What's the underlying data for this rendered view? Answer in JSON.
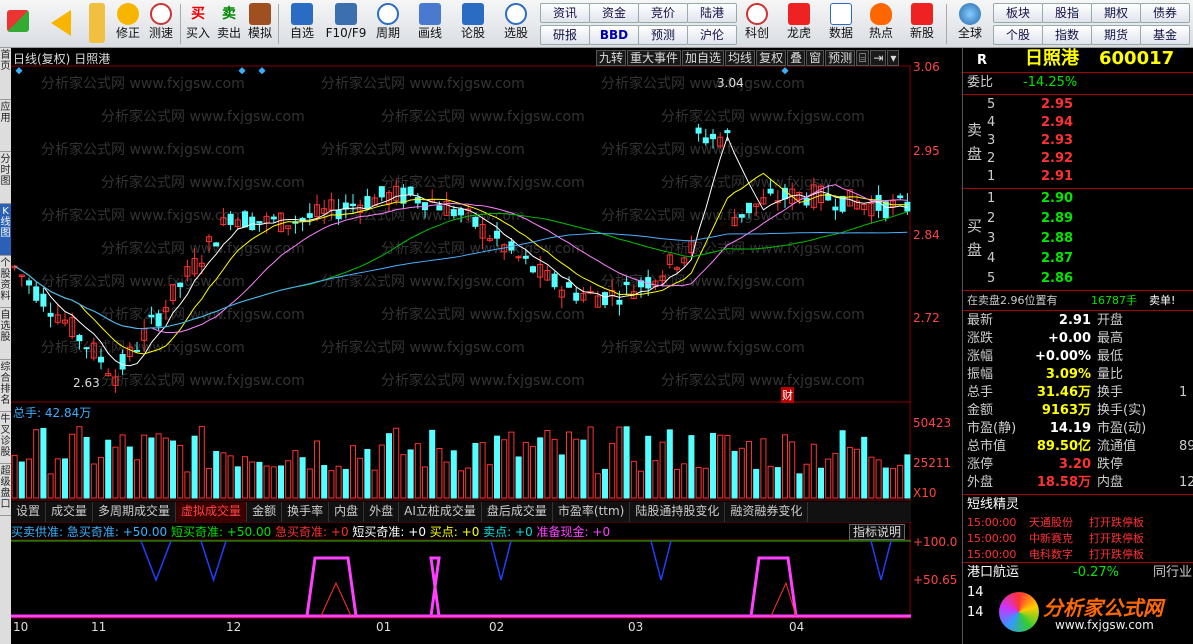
{
  "toolbar": {
    "buttons": [
      {
        "label": "修正"
      },
      {
        "label": "测速"
      },
      {
        "label": "买入"
      },
      {
        "label": "卖出"
      },
      {
        "label": "模拟"
      },
      {
        "label": "自选"
      },
      {
        "label": "F10/F9"
      },
      {
        "label": "周期"
      },
      {
        "label": "画线"
      },
      {
        "label": "论股"
      },
      {
        "label": "选股"
      },
      {
        "label": "科创"
      },
      {
        "label": "龙虎"
      },
      {
        "label": "数据"
      },
      {
        "label": "热点"
      },
      {
        "label": "新股"
      },
      {
        "label": "全球"
      }
    ],
    "nav_row1": [
      "资讯",
      "资金",
      "竞价",
      "陆港"
    ],
    "nav_row2": [
      "研报",
      "BBD",
      "预测",
      "沪伦"
    ],
    "nav_row3a": [
      "板块",
      "股指",
      "期权",
      "债券"
    ],
    "nav_row3b": [
      "个股",
      "指数",
      "期货",
      "基金"
    ],
    "buy_char": "买",
    "sell_char": "卖",
    "trade_chars": [
      "买",
      "卖"
    ]
  },
  "left_tabs": [
    {
      "label": "首页"
    },
    {
      "label": "应用"
    },
    {
      "label": "分时图"
    },
    {
      "label": "K线图",
      "active": true
    },
    {
      "label": "个股资料"
    },
    {
      "label": "自选股"
    },
    {
      "label": "综合排名"
    },
    {
      "label": "牛叉诊股"
    },
    {
      "label": "超级盘口"
    }
  ],
  "chart": {
    "title": "日线(复权)",
    "stock_name": "日照港",
    "buttons": [
      "九转",
      "重大事件",
      "加自选",
      "均线",
      "复权",
      "叠",
      "窗",
      "预测",
      "⌸",
      "⇥",
      "▾"
    ],
    "price_high_label": "3.04",
    "price_low_label": "2.63",
    "fin_marker": "财",
    "volume_label": "总手: 42.84万",
    "axis_price": [
      "3.06",
      "2.95",
      "2.84",
      "2.72"
    ],
    "axis_vol": [
      "50423",
      "25211",
      "X10"
    ],
    "axis_ind": [
      "+100.0",
      "+50.65"
    ],
    "date_labels": [
      "10",
      "11",
      "12",
      "01",
      "02",
      "03",
      "04"
    ],
    "indicator_tabs": [
      "设置",
      "成交量",
      "多周期成交量",
      "虚拟成交量",
      "金额",
      "换手率",
      "内盘",
      "外盘",
      "AI立桩成交量",
      "盘后成交量",
      "市盈率(ttm)",
      "陆股通持股变化",
      "融资融券变化"
    ],
    "active_tab": "虚拟成交量",
    "signal_line": [
      {
        "text": "买卖供准: ",
        "color": "#3ab0ff"
      },
      {
        "text": "急买奇准: +50.00  ",
        "color": "#3ab0ff"
      },
      {
        "text": "短买奇准: +50.00  ",
        "color": "#00e000"
      },
      {
        "text": "急买奇准: +0  ",
        "color": "#ff3030"
      },
      {
        "text": "短买奇准: +0  ",
        "color": "#ffffff"
      },
      {
        "text": "买点: +0  ",
        "color": "#ffff00"
      },
      {
        "text": "卖点: +0  ",
        "color": "#00e0e0"
      },
      {
        "text": "准备现金: +0",
        "color": "#ff40ff"
      }
    ],
    "signal_button": "指标说明",
    "watermark": "分析家公式网 www.fxjgsw.com"
  },
  "chart_data": {
    "type": "candlestick",
    "series_note": "daily K-line, approximate",
    "price_ylim": [
      2.63,
      3.06
    ],
    "high": 3.04,
    "low": 2.63,
    "last_volume": "42.84万"
  },
  "quote": {
    "r_label": "R",
    "name": "日照港",
    "code": "600017",
    "weibi_label": "委比",
    "weibi": "-14.25%",
    "sell_label": "卖盘",
    "buy_label": "买盘",
    "sells": [
      {
        "n": "5",
        "p": "2.95",
        "v": ""
      },
      {
        "n": "4",
        "p": "2.94",
        "v": ""
      },
      {
        "n": "3",
        "p": "2.93",
        "v": ""
      },
      {
        "n": "2",
        "p": "2.92",
        "v": ""
      },
      {
        "n": "1",
        "p": "2.91",
        "v": ""
      }
    ],
    "buys": [
      {
        "n": "1",
        "p": "2.90",
        "v": ""
      },
      {
        "n": "2",
        "p": "2.89",
        "v": ""
      },
      {
        "n": "3",
        "p": "2.88",
        "v": ""
      },
      {
        "n": "4",
        "p": "2.87",
        "v": ""
      },
      {
        "n": "5",
        "p": "2.86",
        "v": ""
      }
    ],
    "queue_text": "在卖盘2.96位置有",
    "queue_vol": "16787手",
    "queue_action": "卖单!",
    "stats": [
      {
        "k1": "最新",
        "v1": "2.91",
        "c1": "wht",
        "k2": "开盘"
      },
      {
        "k1": "涨跌",
        "v1": "+0.00",
        "c1": "wht",
        "k2": "最高"
      },
      {
        "k1": "涨幅",
        "v1": "+0.00%",
        "c1": "wht",
        "k2": "最低"
      },
      {
        "k1": "振幅",
        "v1": "3.09%",
        "c1": "yel",
        "k2": "量比"
      },
      {
        "k1": "总手",
        "v1": "31.46万",
        "c1": "yel",
        "k2": "换手"
      },
      {
        "k1": "金额",
        "v1": "9163万",
        "c1": "yel",
        "k2": "换手(实)"
      },
      {
        "k1": "市盈(静)",
        "v1": "14.19",
        "c1": "wht",
        "k2": "市盈(动)"
      },
      {
        "k1": "总市值",
        "v1": "89.50亿",
        "c1": "yel",
        "k2": "流通值"
      },
      {
        "k1": "涨停",
        "v1": "3.20",
        "c1": "red",
        "k2": "跌停"
      },
      {
        "k1": "外盘",
        "v1": "18.58万",
        "c1": "red",
        "k2": "内盘"
      }
    ],
    "stat_right_vals": [
      "",
      "",
      "",
      "",
      "1",
      "",
      "",
      "89",
      "",
      "12"
    ],
    "news_title": "短线精灵",
    "news": [
      {
        "time": "15:00:00",
        "stock": "天通股份",
        "event": "打开跌停板"
      },
      {
        "time": "15:00:00",
        "stock": "中新赛克",
        "event": "打开跌停板"
      },
      {
        "time": "15:00:00",
        "stock": "电科数字",
        "event": "打开跌停板"
      }
    ],
    "industry": "港口航运",
    "industry_chg": "-0.27%",
    "industry_more": "同行业",
    "bottom_nums": [
      "14",
      "14"
    ],
    "logo_text": "分析家公式网",
    "logo_url": "www.fxjgsw.com"
  }
}
